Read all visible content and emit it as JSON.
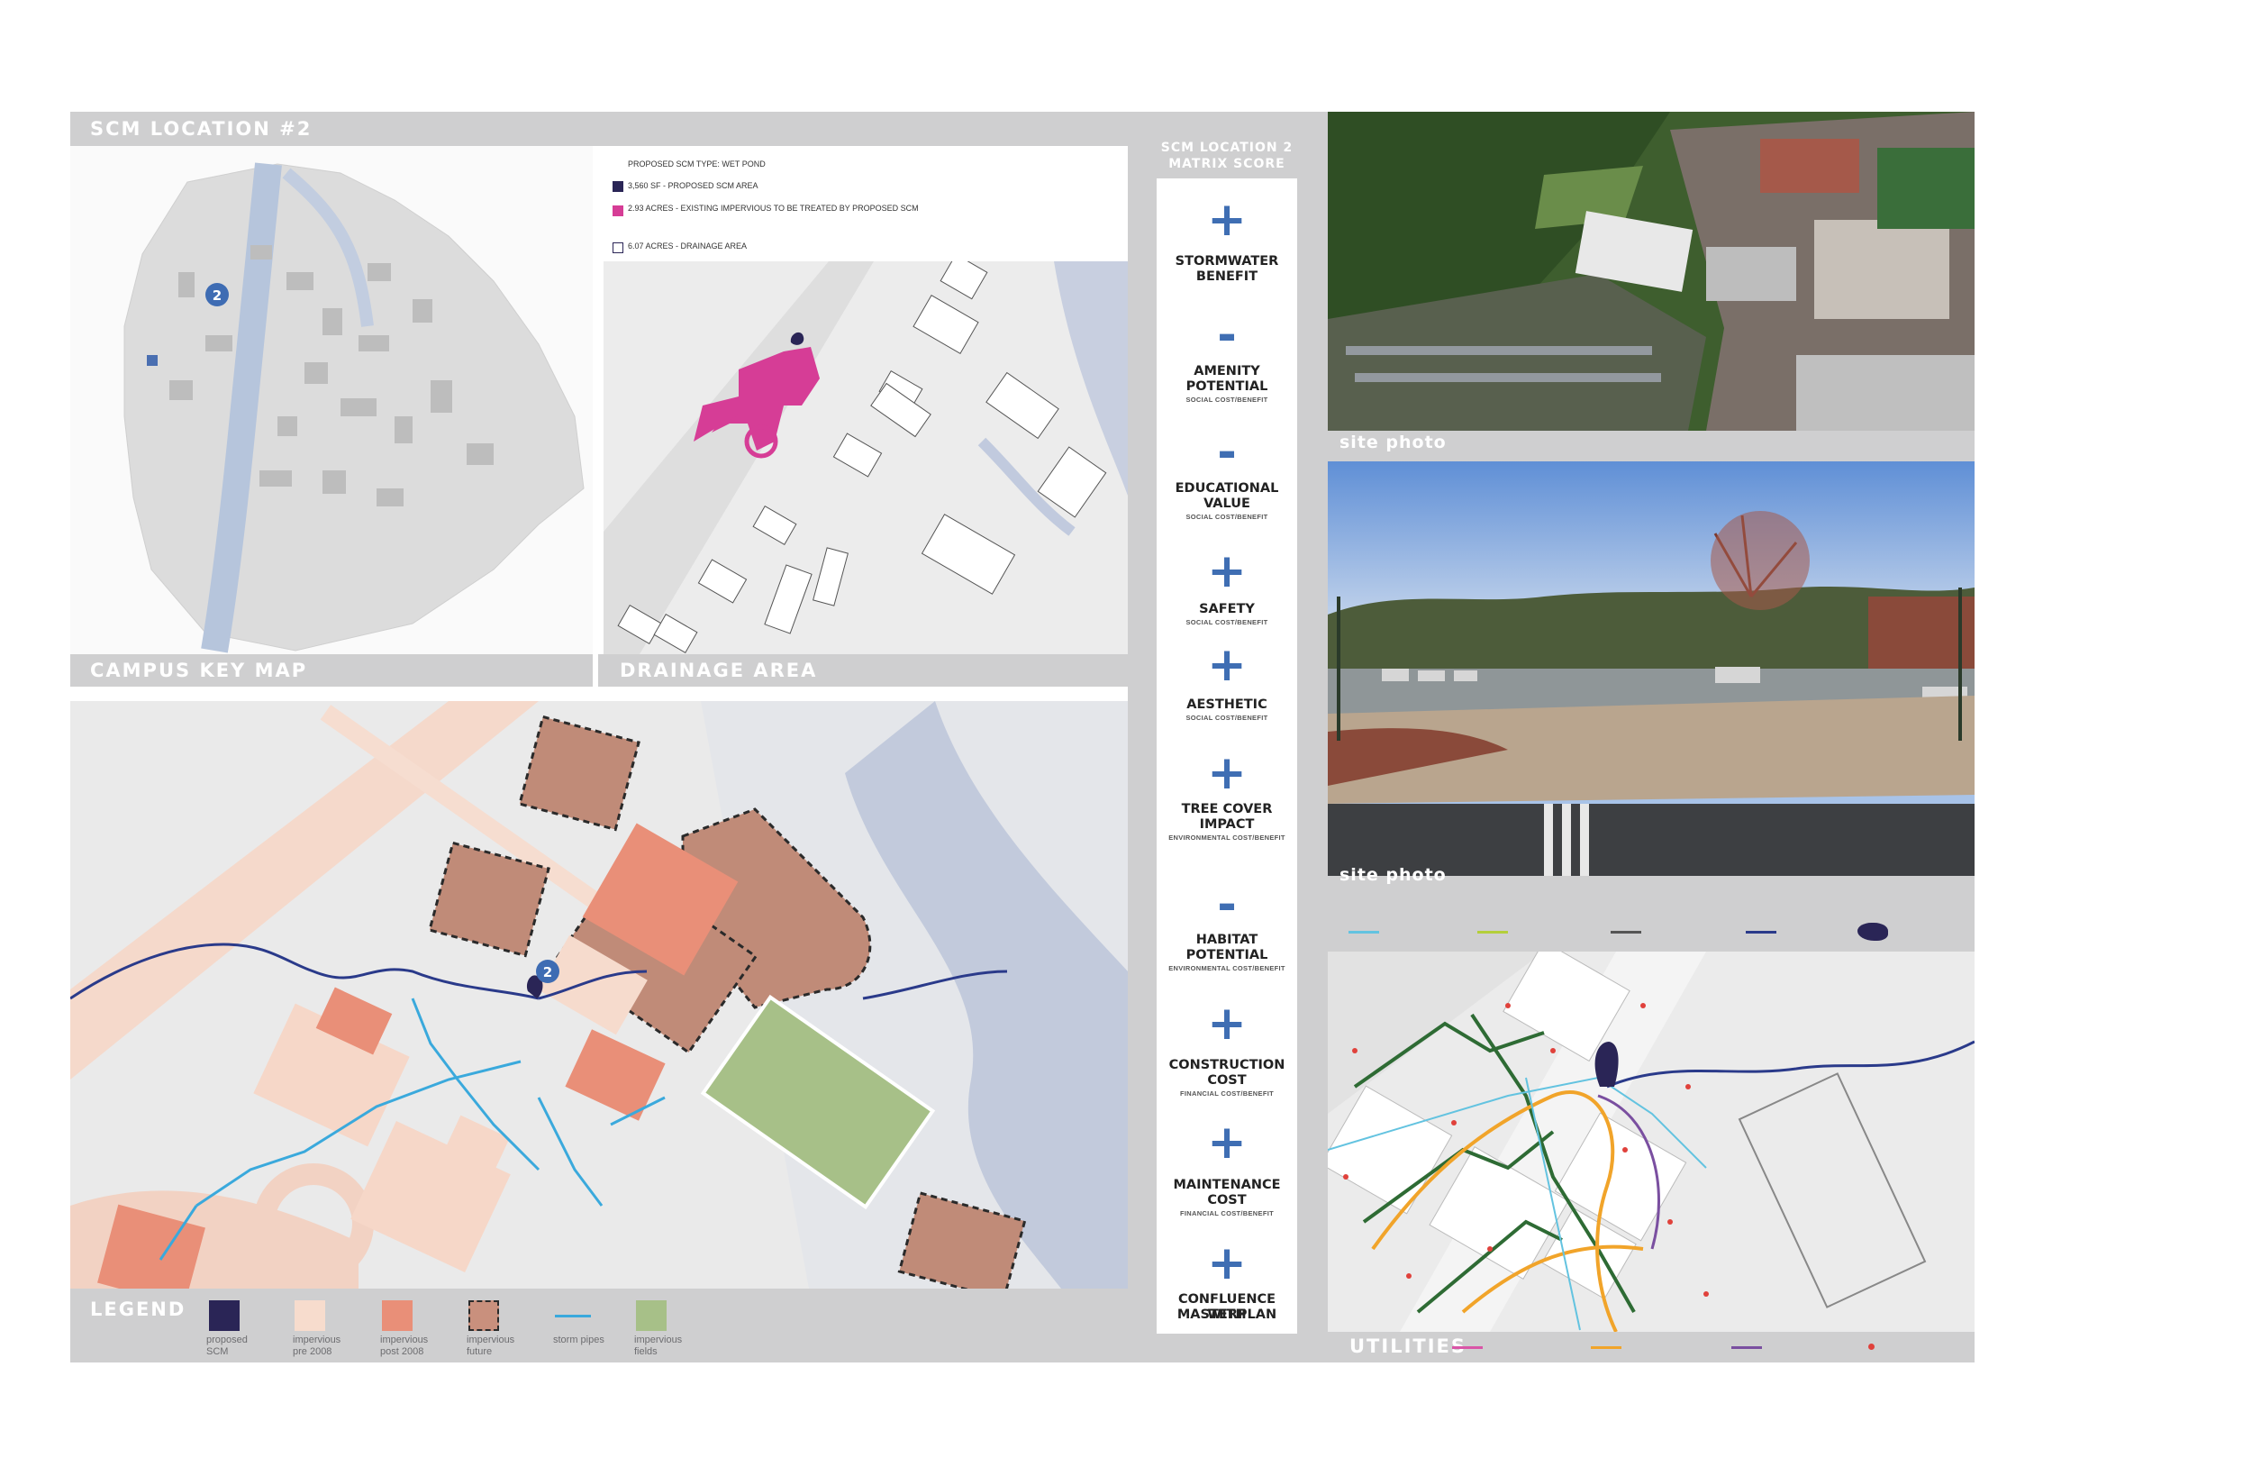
{
  "header": {
    "location_title": "SCM LOCATION #2",
    "campus_key_map": "CAMPUS KEY MAP",
    "drainage_area": "DRAINAGE AREA",
    "legend_title": "LEGEND",
    "utilities": "UTILITIES"
  },
  "key": {
    "scm_type": "PROPOSED SCM TYPE: WET POND",
    "item1": "3,560 SF - PROPOSED SCM AREA",
    "item2": "2.93 ACRES - EXISTING IMPERVIOUS TO BE TREATED BY PROPOSED SCM",
    "item3": "6.07 ACRES - DRAINAGE AREA",
    "colors": {
      "scm": "#2a2556",
      "impervious": "#d63d96",
      "drainage": "#ffffff"
    }
  },
  "map_marker": "2",
  "matrix": {
    "title_line1": "SCM LOCATION 2",
    "title_line2": "MATRIX SCORE",
    "items": [
      {
        "sign": "+",
        "label1": "STORMWATER",
        "label2": "BENEFIT",
        "sub": ""
      },
      {
        "sign": "-",
        "label1": "AMENITY",
        "label2": "POTENTIAL",
        "sub": "SOCIAL COST/BENEFIT"
      },
      {
        "sign": "-",
        "label1": "EDUCATIONAL",
        "label2": "VALUE",
        "sub": "SOCIAL COST/BENEFIT"
      },
      {
        "sign": "+",
        "label1": "SAFETY",
        "label2": "",
        "sub": "SOCIAL COST/BENEFIT"
      },
      {
        "sign": "+",
        "label1": "AESTHETIC",
        "label2": "",
        "sub": "SOCIAL COST/BENEFIT"
      },
      {
        "sign": "+",
        "label1": "TREE COVER",
        "label2": "IMPACT",
        "sub": "ENVIRONMENTAL COST/BENEFIT"
      },
      {
        "sign": "-",
        "label1": "HABITAT",
        "label2": "POTENTIAL",
        "sub": "ENVIRONMENTAL COST/BENEFIT"
      },
      {
        "sign": "+",
        "label1": "CONSTRUCTION",
        "label2": "COST",
        "sub": "FINANCIAL COST/BENEFIT"
      },
      {
        "sign": "+",
        "label1": "MAINTENANCE",
        "label2": "COST",
        "sub": "FINANCIAL COST/BENEFIT"
      },
      {
        "sign": "+",
        "label1": "CONFLUENCE WITH",
        "label2": "MASTERPLAN",
        "sub": ""
      }
    ]
  },
  "photos": {
    "photo1_label": "site photo",
    "photo2_label": "site photo"
  },
  "legend": [
    {
      "line1": "proposed",
      "line2": "SCM",
      "color": "#2a2556"
    },
    {
      "line1": "impervious",
      "line2": "pre 2008",
      "color": "#f7dccd"
    },
    {
      "line1": "impervious",
      "line2": "post 2008",
      "color": "#e98f78"
    },
    {
      "line1": "impervious",
      "line2": "future",
      "color": "#c9907d"
    },
    {
      "line1": "storm pipes",
      "line2": "",
      "color": "#3aa9dc"
    },
    {
      "line1": "impervious",
      "line2": "fields",
      "color": "#a7c088"
    }
  ],
  "utility_colors": {
    "storm": "#63c3e0",
    "sewer": "#b4cf3a",
    "comm": "#555555",
    "water": "#2a3a8a",
    "gas": "#d955a7",
    "electric": "#f1a42a",
    "steam": "#7a4fa0",
    "poles": "#e0413b",
    "green": "#2e6b34"
  }
}
